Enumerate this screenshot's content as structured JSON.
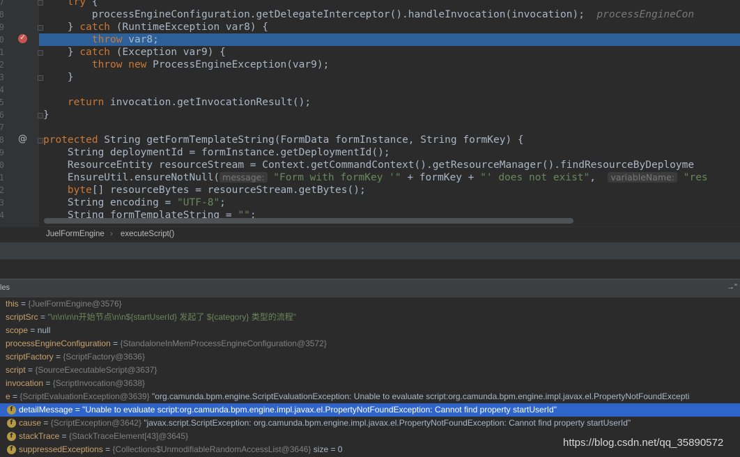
{
  "editor": {
    "line_numbers": [
      "7",
      "8",
      "9",
      "0",
      "1",
      "2",
      "3",
      "4",
      "5",
      "6",
      "7",
      "8",
      "9",
      "0",
      "1",
      "2",
      "3",
      "4"
    ],
    "lines": [
      {
        "segments": [
          {
            "t": "    "
          },
          {
            "t": "try",
            "c": "kw"
          },
          {
            "t": " {"
          }
        ]
      },
      {
        "segments": [
          {
            "t": "        processEngineConfiguration.getDelegateInterceptor().handleInvocation(invocation);  "
          },
          {
            "t": "processEngineCon",
            "c": "hint"
          }
        ]
      },
      {
        "segments": [
          {
            "t": "    } "
          },
          {
            "t": "catch",
            "c": "kw"
          },
          {
            "t": " (RuntimeException var8) {"
          }
        ]
      },
      {
        "segments": [
          {
            "t": "        "
          },
          {
            "t": "throw",
            "c": "kw"
          },
          {
            "t": " var8;"
          }
        ],
        "highlight": true
      },
      {
        "segments": [
          {
            "t": "    } "
          },
          {
            "t": "catch",
            "c": "kw"
          },
          {
            "t": " (Exception var9) {"
          }
        ]
      },
      {
        "segments": [
          {
            "t": "        "
          },
          {
            "t": "throw new",
            "c": "kw"
          },
          {
            "t": " ProcessEngineException(var9);"
          }
        ]
      },
      {
        "segments": [
          {
            "t": "    }"
          }
        ]
      },
      {
        "segments": [
          {
            "t": ""
          }
        ]
      },
      {
        "segments": [
          {
            "t": "    "
          },
          {
            "t": "return",
            "c": "kw"
          },
          {
            "t": " invocation.getInvocationResult();"
          }
        ]
      },
      {
        "segments": [
          {
            "t": "}"
          }
        ]
      },
      {
        "segments": [
          {
            "t": ""
          }
        ]
      },
      {
        "segments": [
          {
            "t": "protected",
            "c": "kw"
          },
          {
            "t": " String getFormTemplateString(FormData formInstance, String formKey) {"
          }
        ]
      },
      {
        "segments": [
          {
            "t": "    String deploymentId = formInstance.getDeploymentId();"
          }
        ]
      },
      {
        "segments": [
          {
            "t": "    ResourceEntity resourceStream = Context.getCommandContext().getResourceManager().findResourceByDeployme"
          }
        ]
      },
      {
        "segments": [
          {
            "t": "    EnsureUtil.ensureNotNull("
          },
          {
            "t": "message:",
            "c": "inlay"
          },
          {
            "t": " "
          },
          {
            "t": "\"Form with formKey '\"",
            "c": "str"
          },
          {
            "t": " + formKey + "
          },
          {
            "t": "\"' does not exist\"",
            "c": "str"
          },
          {
            "t": ",  "
          },
          {
            "t": "variableName:",
            "c": "inlay"
          },
          {
            "t": " "
          },
          {
            "t": "\"res",
            "c": "str"
          }
        ]
      },
      {
        "segments": [
          {
            "t": "    "
          },
          {
            "t": "byte",
            "c": "kw"
          },
          {
            "t": "[] resourceBytes = resourceStream.getBytes();"
          }
        ]
      },
      {
        "segments": [
          {
            "t": "    String encoding = "
          },
          {
            "t": "\"UTF-8\"",
            "c": "str"
          },
          {
            "t": ";"
          }
        ]
      },
      {
        "segments": [
          {
            "t": "    String formTemplateString = "
          },
          {
            "t": "\"\"",
            "c": "str"
          },
          {
            "t": ";"
          }
        ]
      }
    ]
  },
  "breadcrumb": {
    "class_name": "JuelFormEngine",
    "separator": "›",
    "method_name": "executeScript()"
  },
  "variables_panel": {
    "title": "les",
    "collapse_glyph": "→\""
  },
  "variables": [
    {
      "name": "this",
      "eq": " = ",
      "ref": "{JuelFormEngine@3576}",
      "value": "",
      "field_icon": false,
      "selected": false
    },
    {
      "name": "scriptSrc",
      "eq": " = ",
      "ref": "",
      "value": "\"\\n\\n\\n\\n开始节点\\n\\n${startUserId} 发起了 ${category} 类型的流程\"",
      "value_is_string": true,
      "field_icon": false,
      "selected": false
    },
    {
      "name": "scope",
      "eq": " = ",
      "ref": "",
      "value": "null",
      "field_icon": false,
      "selected": false
    },
    {
      "name": "processEngineConfiguration",
      "eq": " = ",
      "ref": "{StandaloneInMemProcessEngineConfiguration@3572}",
      "value": "",
      "field_icon": false,
      "selected": false
    },
    {
      "name": "scriptFactory",
      "eq": " = ",
      "ref": "{ScriptFactory@3636}",
      "value": "",
      "field_icon": false,
      "selected": false
    },
    {
      "name": "script",
      "eq": " = ",
      "ref": "{SourceExecutableScript@3637}",
      "value": "",
      "field_icon": false,
      "selected": false
    },
    {
      "name": "invocation",
      "eq": " = ",
      "ref": "{ScriptInvocation@3638}",
      "value": "",
      "field_icon": false,
      "selected": false
    },
    {
      "name": "e",
      "eq": " = ",
      "ref": "{ScriptEvaluationException@3639}",
      "value": " \"org.camunda.bpm.engine.ScriptEvaluationException: Unable to evaluate script:org.camunda.bpm.engine.impl.javax.el.PropertyNotFoundExcepti",
      "field_icon": false,
      "selected": false,
      "expander": "▾"
    },
    {
      "name": "detailMessage",
      "eq": " = ",
      "ref": "",
      "value": "\"Unable to evaluate script:org.camunda.bpm.engine.impl.javax.el.PropertyNotFoundException: Cannot find property startUserId\"",
      "field_icon": true,
      "selected": true
    },
    {
      "name": "cause",
      "eq": " = ",
      "ref": "{ScriptException@3642}",
      "value": " \"javax.script.ScriptException: org.camunda.bpm.engine.impl.javax.el.PropertyNotFoundException: Cannot find property startUserId\"",
      "field_icon": true,
      "selected": false
    },
    {
      "name": "stackTrace",
      "eq": " = ",
      "ref": "{StackTraceElement[43]@3645}",
      "value": "",
      "field_icon": true,
      "selected": false
    },
    {
      "name": "suppressedExceptions",
      "eq": " = ",
      "ref": "{Collections$UnmodifiableRandomAccessList@3646}",
      "value": "  size = 0",
      "field_icon": true,
      "selected": false
    }
  ],
  "field_icon_letter": "f",
  "watermark": "https://blog.csdn.net/qq_35890572",
  "colors": {
    "editor_bg": "#2b2b2b",
    "keyword": "#cc7832",
    "string": "#6a8759",
    "highlight_line": "#2d6099",
    "selected_row": "#2f65ca",
    "breakpoint": "#c75450"
  }
}
